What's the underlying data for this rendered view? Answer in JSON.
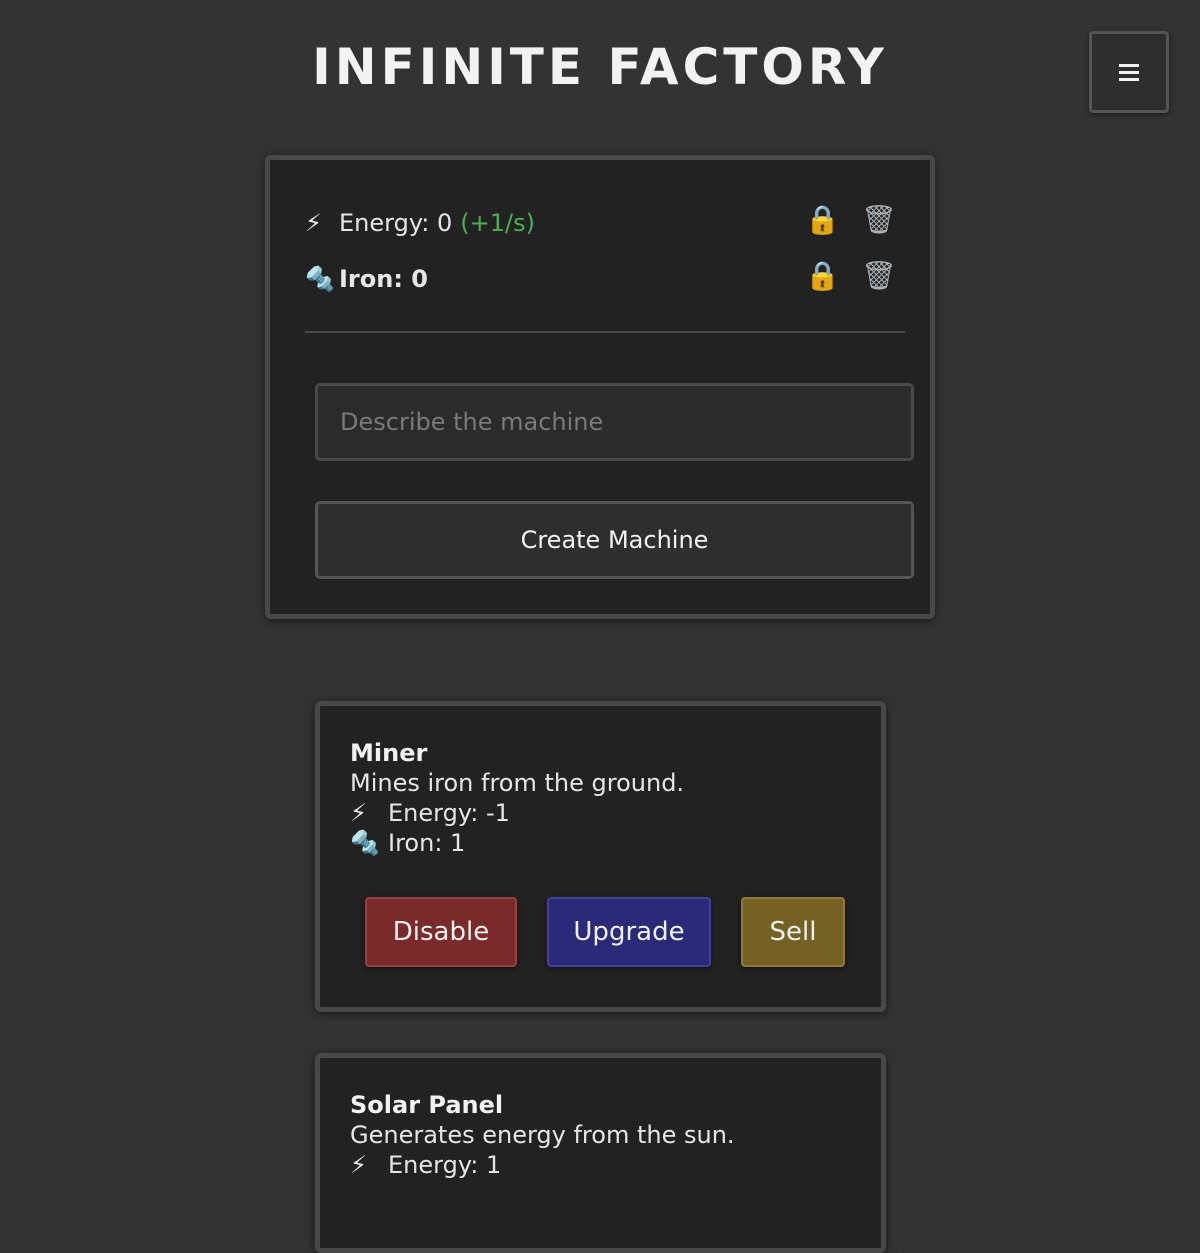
{
  "app": {
    "title": "INFINITE FACTORY",
    "menu_icon": "hamburger-menu-icon"
  },
  "resources": [
    {
      "icon": "lightning-icon",
      "glyph": "⚡",
      "label": "Energy: 0",
      "rate": "(+1/s)",
      "lock_icon": "lock-icon",
      "lock_glyph": "🔒",
      "trash_icon": "trash-icon",
      "trash_glyph": "🗑"
    },
    {
      "icon": "bolt-nut-icon",
      "glyph": "🔩",
      "label": "Iron: 0",
      "rate": "",
      "lock_icon": "lock-icon",
      "lock_glyph": "🔒",
      "trash_icon": "trash-icon",
      "trash_glyph": "🗑"
    }
  ],
  "builder": {
    "input_placeholder": "Describe the machine",
    "input_value": "",
    "create_label": "Create Machine"
  },
  "machines": [
    {
      "name": "Miner",
      "description": "Mines iron from the ground.",
      "stats": [
        {
          "icon": "lightning-icon",
          "glyph": "⚡",
          "text": "Energy: -1"
        },
        {
          "icon": "bolt-nut-icon",
          "glyph": "🔩",
          "text": "Iron: 1"
        }
      ],
      "buttons": {
        "disable": "Disable",
        "upgrade": "Upgrade",
        "sell": "Sell"
      }
    },
    {
      "name": "Solar Panel",
      "description": "Generates energy from the sun.",
      "stats": [
        {
          "icon": "lightning-icon",
          "glyph": "⚡",
          "text": "Energy: 1"
        }
      ]
    }
  ],
  "colors": {
    "background": "#333333",
    "panel": "#222222",
    "rate_green": "#4caf50",
    "disable_red": "#7a2a2a",
    "upgrade_blue": "#2a2a78",
    "sell_gold": "#766124"
  }
}
